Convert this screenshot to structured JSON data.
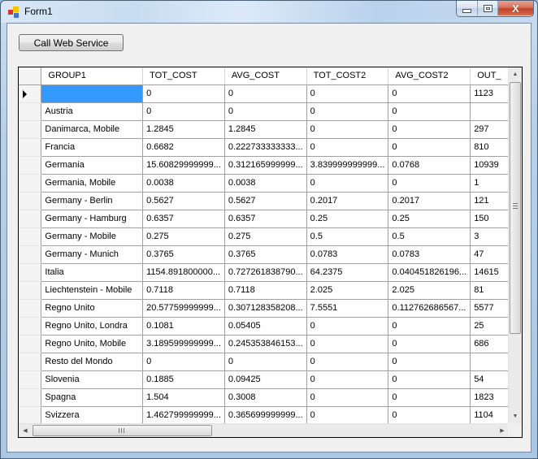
{
  "window": {
    "title": "Form1",
    "icon": "winforms-app-icon",
    "controls": {
      "minimize": "minimize-icon",
      "maximize": "maximize-icon",
      "close": "close-icon",
      "close_glyph": "X"
    }
  },
  "toolbar": {
    "call_web_service_label": "Call Web Service"
  },
  "grid": {
    "columns": [
      "GROUP1",
      "TOT_COST",
      "AVG_COST",
      "TOT_COST2",
      "AVG_COST2",
      "OUT_"
    ],
    "current_row_index": 0,
    "rows": [
      [
        "",
        "0",
        "0",
        "0",
        "0",
        "1123"
      ],
      [
        "Austria",
        "0",
        "0",
        "0",
        "0",
        ""
      ],
      [
        "Danimarca, Mobile",
        "1.2845",
        "1.2845",
        "0",
        "0",
        "297"
      ],
      [
        "Francia",
        "0.6682",
        "0.222733333333...",
        "0",
        "0",
        "810"
      ],
      [
        "Germania",
        "15.60829999999...",
        "0.312165999999...",
        "3.839999999999...",
        "0.0768",
        "10939"
      ],
      [
        "Germania, Mobile",
        "0.0038",
        "0.0038",
        "0",
        "0",
        "1"
      ],
      [
        "Germany - Berlin",
        "0.5627",
        "0.5627",
        "0.2017",
        "0.2017",
        "121"
      ],
      [
        "Germany - Hamburg",
        "0.6357",
        "0.6357",
        "0.25",
        "0.25",
        "150"
      ],
      [
        "Germany - Mobile",
        "0.275",
        "0.275",
        "0.5",
        "0.5",
        "3"
      ],
      [
        "Germany - Munich",
        "0.3765",
        "0.3765",
        "0.0783",
        "0.0783",
        "47"
      ],
      [
        "Italia",
        "1154.891800000...",
        "0.727261838790...",
        "64.2375",
        "0.040451826196...",
        "14615"
      ],
      [
        "Liechtenstein - Mobile",
        "0.7118",
        "0.7118",
        "2.025",
        "2.025",
        "81"
      ],
      [
        "Regno Unito",
        "20.57759999999...",
        "0.307128358208...",
        "7.5551",
        "0.112762686567...",
        "5577"
      ],
      [
        "Regno Unito, Londra",
        "0.1081",
        "0.05405",
        "0",
        "0",
        "25"
      ],
      [
        "Regno Unito, Mobile",
        "3.189599999999...",
        "0.245353846153...",
        "0",
        "0",
        "686"
      ],
      [
        "Resto del Mondo",
        "0",
        "0",
        "0",
        "0",
        ""
      ],
      [
        "Slovenia",
        "0.1885",
        "0.09425",
        "0",
        "0",
        "54"
      ],
      [
        "Spagna",
        "1.504",
        "0.3008",
        "0",
        "0",
        "1823"
      ],
      [
        "Svizzera",
        "1.462799999999...",
        "0.365699999999...",
        "0",
        "0",
        "1104"
      ]
    ]
  },
  "scrollbars": {
    "vertical": {
      "up_glyph": "▲",
      "down_glyph": "▼",
      "grip": "grip-icon"
    },
    "horizontal": {
      "left_glyph": "◀",
      "right_glyph": "▶",
      "grip": "grip-icon"
    }
  },
  "colors": {
    "selection": "#3399ff",
    "close_button": "#c84a30",
    "app_icon": [
      "#d9342b",
      "#f5c400",
      "#3a76d8",
      "#8ab4e8"
    ]
  }
}
